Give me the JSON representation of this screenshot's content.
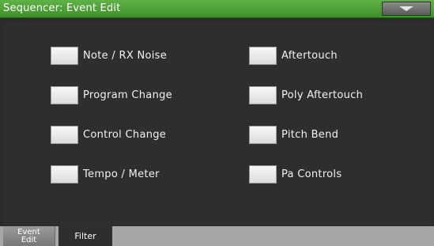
{
  "title": "Sequencer: Event Edit",
  "menu_icon": "chevron-down-icon",
  "options": [
    {
      "label": "Note / RX Noise",
      "checked": false
    },
    {
      "label": "Program Change",
      "checked": false
    },
    {
      "label": "Control Change",
      "checked": false
    },
    {
      "label": "Tempo / Meter",
      "checked": false
    },
    {
      "label": "Aftertouch",
      "checked": false
    },
    {
      "label": "Poly Aftertouch",
      "checked": false
    },
    {
      "label": "Pitch Bend",
      "checked": false
    },
    {
      "label": "Pa Controls",
      "checked": false
    }
  ],
  "tabs": [
    {
      "line1": "Event",
      "line2": "Edit",
      "active": false
    },
    {
      "label": "Filter",
      "active": true
    }
  ],
  "colors": {
    "titlebar": "#4fa23a",
    "panel": "#2e2e2e",
    "tabbar": "#a6a6a6"
  }
}
